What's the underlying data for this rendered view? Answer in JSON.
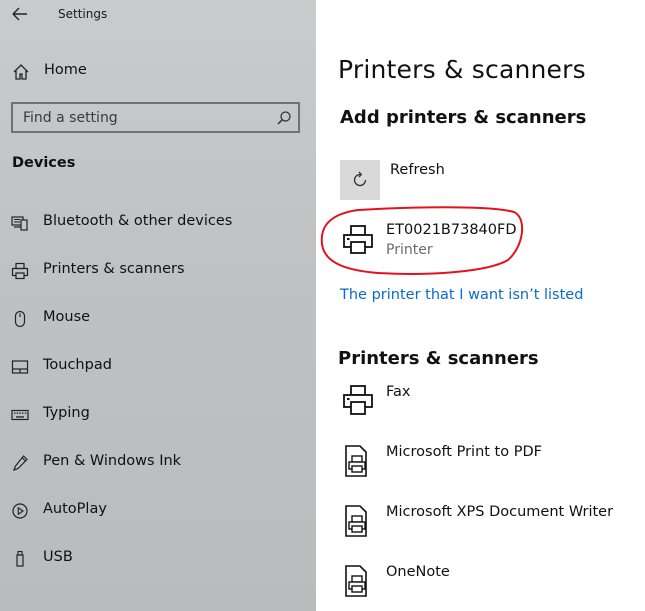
{
  "window": {
    "title": "Settings",
    "back_icon": "back-arrow-icon"
  },
  "sidebar": {
    "home_label": "Home",
    "home_icon": "home-icon",
    "search": {
      "placeholder": "Find a setting",
      "value": "",
      "icon": "search-icon"
    },
    "section_heading": "Devices",
    "items": [
      {
        "label": "Bluetooth & other devices",
        "icon": "bluetooth-devices-icon"
      },
      {
        "label": "Printers & scanners",
        "icon": "printer-icon"
      },
      {
        "label": "Mouse",
        "icon": "mouse-icon"
      },
      {
        "label": "Touchpad",
        "icon": "touchpad-icon"
      },
      {
        "label": "Typing",
        "icon": "keyboard-icon"
      },
      {
        "label": "Pen & Windows Ink",
        "icon": "pen-icon"
      },
      {
        "label": "AutoPlay",
        "icon": "autoplay-icon"
      },
      {
        "label": "USB",
        "icon": "usb-icon"
      }
    ]
  },
  "main": {
    "page_title": "Printers & scanners",
    "add_heading": "Add printers & scanners",
    "refresh": {
      "label": "Refresh",
      "icon": "refresh-icon"
    },
    "found_printer": {
      "name": "ET0021B73840FD",
      "type": "Printer",
      "icon": "printer-icon"
    },
    "annotation_color": "#e0141e",
    "not_listed_link": "The printer that I want isn’t listed",
    "list_heading": "Printers & scanners",
    "printers": [
      {
        "name": "Fax",
        "icon": "printer-icon"
      },
      {
        "name": "Microsoft Print to PDF",
        "icon": "printer-document-icon"
      },
      {
        "name": "Microsoft XPS Document Writer",
        "icon": "printer-document-icon"
      },
      {
        "name": "OneNote",
        "icon": "printer-document-icon"
      }
    ]
  },
  "colors": {
    "sidebar_bg": "#c0c2c4",
    "link": "#0b6bc9",
    "refresh_tile": "#d9d9d9",
    "secondary_text": "#6b6b6b"
  }
}
